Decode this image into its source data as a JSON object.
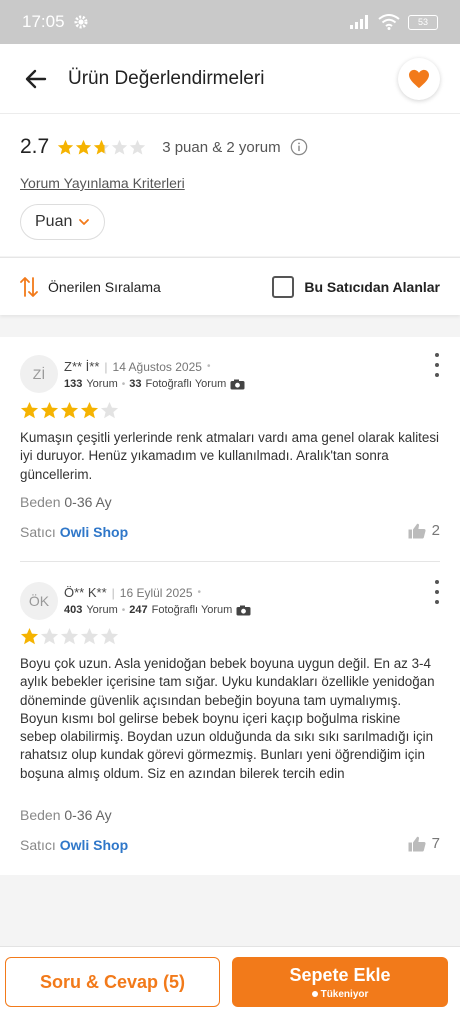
{
  "status_bar": {
    "time": "17:05",
    "battery": "53"
  },
  "header": {
    "title": "Ürün Değerlendirmeleri"
  },
  "summary": {
    "rating": "2.7",
    "rating_stars": 2.7,
    "counts": "3 puan & 2 yorum",
    "criteria_link": "Yorum Yayınlama Kriterleri",
    "filter_label": "Puan"
  },
  "sort": {
    "label": "Önerilen Sıralama",
    "seller_filter": "Bu Satıcıdan Alanlar"
  },
  "reviews": [
    {
      "avatar": "Zİ",
      "name": "Z** İ**",
      "date": "14 Ağustos 2025",
      "review_count": "133",
      "review_label": "Yorum",
      "photo_count": "33",
      "photo_label": "Fotoğraflı Yorum",
      "stars": 4,
      "text": "Kumaşın çeşitli yerlerinde renk atmaları vardı ama genel olarak kalitesi iyi duruyor. Henüz yıkamadım ve kullanılmadı. Aralık'tan sonra güncellerim.",
      "size_label": "Beden",
      "size_value": "0-36 Ay",
      "seller_label": "Satıcı",
      "seller_name": "Owli Shop",
      "likes": "2"
    },
    {
      "avatar": "ÖK",
      "name": "Ö** K**",
      "date": "16 Eylül 2025",
      "review_count": "403",
      "review_label": "Yorum",
      "photo_count": "247",
      "photo_label": "Fotoğraflı Yorum",
      "stars": 1,
      "text": "Boyu çok uzun. Asla yenidoğan bebek boyuna uygun değil. En az 3-4 aylık bebekler içerisine tam sığar. Uyku kundakları özellikle yenidoğan döneminde güvenlik açısından bebeğin boyuna tam uymalıymış. Boyun kısmı bol gelirse bebek boynu içeri kaçıp boğulma riskine sebep olabilirmiş. Boydan uzun olduğunda da sıkı sıkı sarılmadığı için rahatsız olup kundak görevi görmezmiş. Bunları yeni öğrendiğim için boşuna almış oldum. Siz en azından bilerek tercih edin",
      "size_label": "Beden",
      "size_value": "0-36 Ay",
      "seller_label": "Satıcı",
      "seller_name": "Owli Shop",
      "likes": "7"
    }
  ],
  "bottom_bar": {
    "qa_label": "Soru & Cevap (5)",
    "cart_label": "Sepete Ekle",
    "cart_sub": "Tükeniyor"
  },
  "colors": {
    "accent": "#f27a1a",
    "star": "#f5b301",
    "star_empty": "#e3e3e3",
    "link": "#2f77c9"
  }
}
